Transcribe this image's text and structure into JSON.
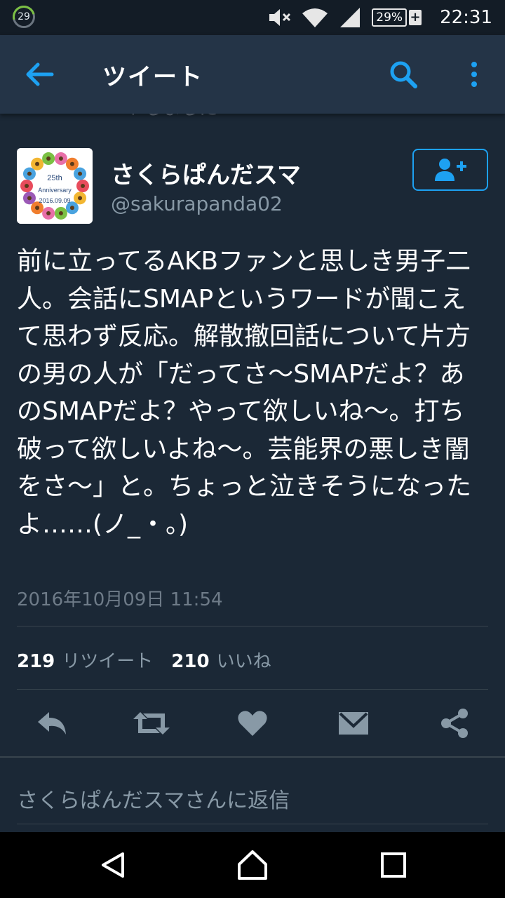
{
  "status_bar": {
    "notification_count": "29",
    "battery_percent": "29%",
    "time": "22:31",
    "icons": [
      "volume-mute-icon",
      "wifi-icon",
      "cell-signal-icon",
      "battery-charging-icon"
    ]
  },
  "app_bar": {
    "title": "ツイート",
    "icons": [
      "back-arrow-icon",
      "search-icon",
      "more-vert-icon"
    ]
  },
  "previous_tweet_remnant": "トしました",
  "tweet": {
    "author": {
      "display_name": "さくらぱんだスマ",
      "handle": "@sakurapanda02",
      "avatar_text_line1": "25th",
      "avatar_text_line2": "Anniversary",
      "avatar_text_line3": "2016.09.09"
    },
    "text": "前に立ってるAKBファンと思しき男子二人。会話にSMAPというワードが聞こえて思わず反応。解散撤回話について片方の男の人が「だってさ〜SMAPだよ？あのSMAPだよ？やって欲しいね〜。打ち破って欲しいよね〜。芸能界の悪しき闇をさ〜」と。ちょっと泣きそうになったよ……(ノ_・。)",
    "timestamp": "2016年10月09日 11:54",
    "retweet_count": "219",
    "retweet_label": "リツイート",
    "like_count": "210",
    "like_label": "いいね"
  },
  "actions": [
    "reply-icon",
    "retweet-icon",
    "like-icon",
    "message-icon",
    "share-icon"
  ],
  "reply_placeholder": "さくらぱんだスマさんに返信",
  "colors": {
    "background": "#1b2836",
    "app_bar": "#243447",
    "accent": "#1da1f2",
    "secondary_text": "#8899a6",
    "divider": "#38444d"
  }
}
